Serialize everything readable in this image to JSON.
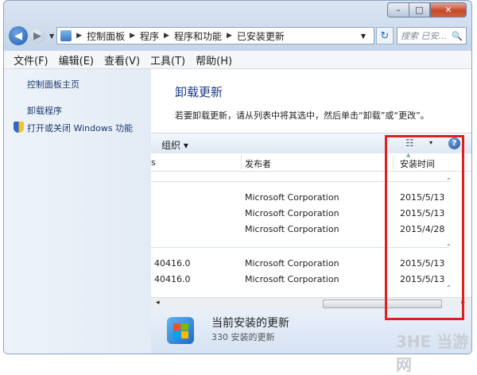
{
  "window": {
    "minimize": "–",
    "maximize": "□",
    "close": "✕"
  },
  "address": {
    "icon": "control-panel-icon",
    "crumbs": [
      "控制面板",
      "程序",
      "程序和功能",
      "已安装更新"
    ],
    "search_placeholder": "搜索 已安...",
    "search_icon": "🔍"
  },
  "menu": [
    "文件(F)",
    "编辑(E)",
    "查看(V)",
    "工具(T)",
    "帮助(H)"
  ],
  "sidebar": {
    "home": "控制面板主页",
    "uninstall": "卸载程序",
    "features": "打开或关闭 Windows 功能"
  },
  "main": {
    "title": "卸载更新",
    "description": "若要卸载更新，请从列表中将其选中，然后单击“卸载”或“更改”。"
  },
  "toolbar": {
    "organize": "组织 ▾",
    "view": "☷",
    "view_drop": "▾",
    "help": "?"
  },
  "columns": {
    "name": "s",
    "publisher": "发布者",
    "installed": "安装时间"
  },
  "groups": [
    {
      "rows": [
        {
          "name": "",
          "publisher": "Microsoft Corporation",
          "date": "2015/5/13"
        },
        {
          "name": "",
          "publisher": "Microsoft Corporation",
          "date": "2015/5/13"
        },
        {
          "name": "",
          "publisher": "Microsoft Corporation",
          "date": "2015/4/28"
        }
      ]
    },
    {
      "rows": [
        {
          "name": "40416.0",
          "publisher": "Microsoft Corporation",
          "date": "2015/5/13"
        },
        {
          "name": "40416.0",
          "publisher": "Microsoft Corporation",
          "date": "2015/5/13"
        }
      ]
    }
  ],
  "status": {
    "title": "当前安装的更新",
    "count": "330 安装的更新"
  },
  "watermark": "3HE 当游网",
  "colors": {
    "highlight": "#e0201e",
    "link": "#1b3a6d",
    "title": "#1f3b82"
  }
}
